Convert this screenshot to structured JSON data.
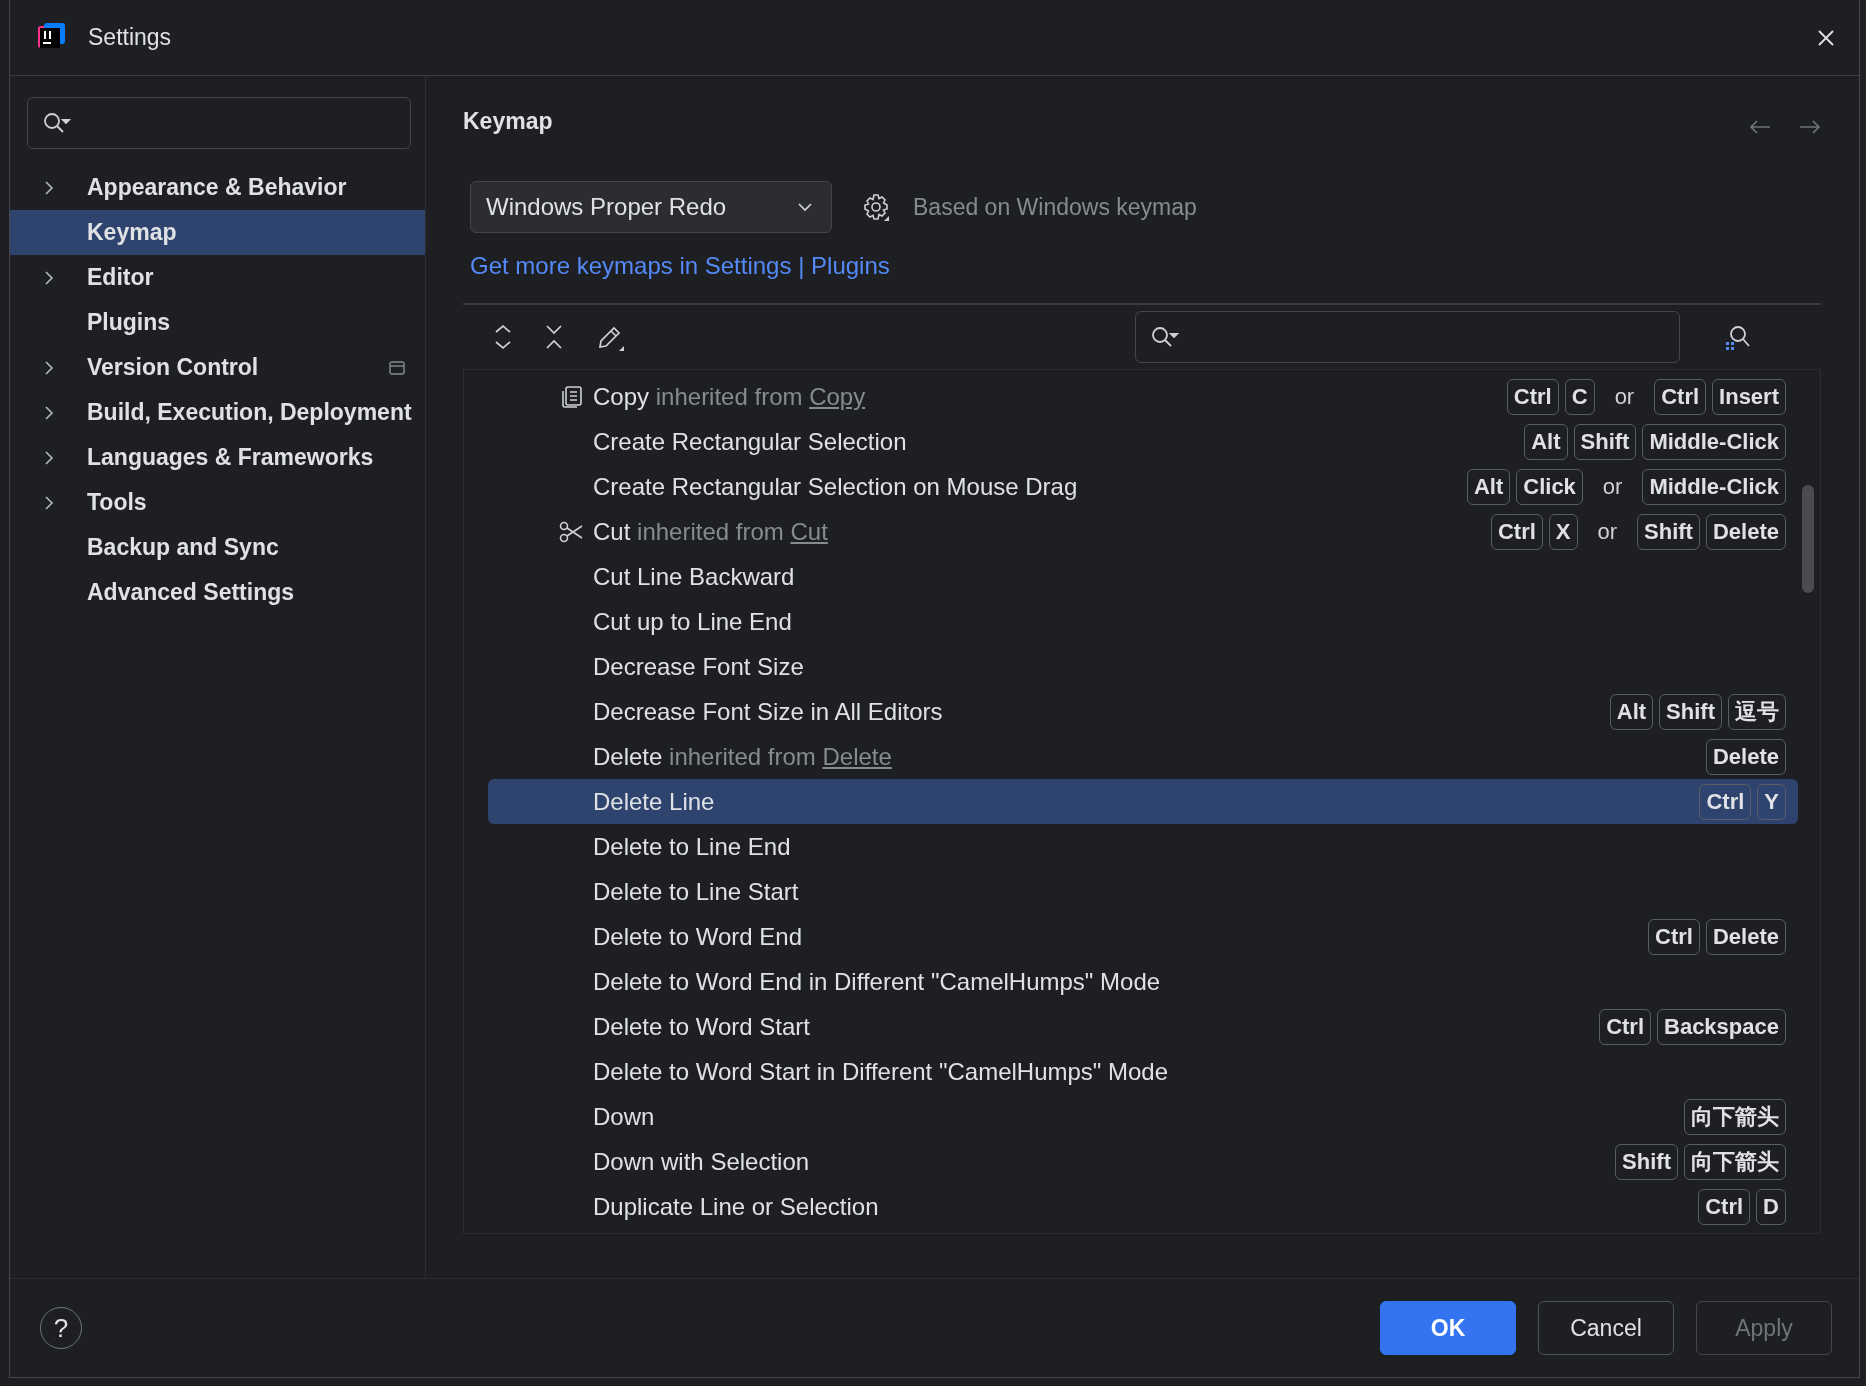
{
  "window": {
    "title": "Settings"
  },
  "sidebar": {
    "items": [
      {
        "label": "Appearance & Behavior",
        "expandable": true,
        "selected": false,
        "project_icon": false
      },
      {
        "label": "Keymap",
        "expandable": false,
        "selected": true,
        "project_icon": false
      },
      {
        "label": "Editor",
        "expandable": true,
        "selected": false,
        "project_icon": false
      },
      {
        "label": "Plugins",
        "expandable": false,
        "selected": false,
        "project_icon": false
      },
      {
        "label": "Version Control",
        "expandable": true,
        "selected": false,
        "project_icon": true
      },
      {
        "label": "Build, Execution, Deployment",
        "expandable": true,
        "selected": false,
        "project_icon": false
      },
      {
        "label": "Languages & Frameworks",
        "expandable": true,
        "selected": false,
        "project_icon": false
      },
      {
        "label": "Tools",
        "expandable": true,
        "selected": false,
        "project_icon": false
      },
      {
        "label": "Backup and Sync",
        "expandable": false,
        "selected": false,
        "project_icon": false
      },
      {
        "label": "Advanced Settings",
        "expandable": false,
        "selected": false,
        "project_icon": false
      }
    ]
  },
  "page": {
    "title": "Keymap",
    "keymap_select": {
      "value": "Windows Proper Redo"
    },
    "based_on": "Based on Windows keymap",
    "link": "Get more keymaps in Settings | Plugins"
  },
  "actions": {
    "rows": [
      {
        "name": "Copy",
        "kind": "copy",
        "inherited": {
          "prefix": "inherited from",
          "target": "Copy"
        },
        "selected": false,
        "shortcuts": [
          {
            "kind": "key",
            "text": "Ctrl"
          },
          {
            "kind": "key",
            "text": "C"
          },
          {
            "kind": "sep",
            "text": "or"
          },
          {
            "kind": "key",
            "text": "Ctrl"
          },
          {
            "kind": "key",
            "text": "Insert"
          }
        ]
      },
      {
        "name": "Create Rectangular Selection",
        "selected": false,
        "shortcuts": [
          {
            "kind": "key",
            "text": "Alt"
          },
          {
            "kind": "key",
            "text": "Shift"
          },
          {
            "kind": "key",
            "text": "Middle-Click"
          }
        ]
      },
      {
        "name": "Create Rectangular Selection on Mouse Drag",
        "selected": false,
        "shortcuts": [
          {
            "kind": "key",
            "text": "Alt"
          },
          {
            "kind": "key",
            "text": "Click"
          },
          {
            "kind": "sep",
            "text": "or"
          },
          {
            "kind": "key",
            "text": "Middle-Click"
          }
        ]
      },
      {
        "name": "Cut",
        "kind": "cut",
        "inherited": {
          "prefix": "inherited from",
          "target": "Cut"
        },
        "selected": false,
        "shortcuts": [
          {
            "kind": "key",
            "text": "Ctrl"
          },
          {
            "kind": "key",
            "text": "X"
          },
          {
            "kind": "sep",
            "text": "or"
          },
          {
            "kind": "key",
            "text": "Shift"
          },
          {
            "kind": "key",
            "text": "Delete"
          }
        ]
      },
      {
        "name": "Cut Line Backward",
        "selected": false
      },
      {
        "name": "Cut up to Line End",
        "selected": false
      },
      {
        "name": "Decrease Font Size",
        "selected": false
      },
      {
        "name": "Decrease Font Size in All Editors",
        "selected": false,
        "shortcuts": [
          {
            "kind": "key",
            "text": "Alt"
          },
          {
            "kind": "key",
            "text": "Shift"
          },
          {
            "kind": "key",
            "text": "逗号"
          }
        ]
      },
      {
        "name": "Delete",
        "inherited": {
          "prefix": "inherited from",
          "target": "Delete"
        },
        "selected": false,
        "shortcuts": [
          {
            "kind": "key",
            "text": "Delete"
          }
        ]
      },
      {
        "name": "Delete Line",
        "selected": true,
        "shortcuts": [
          {
            "kind": "key",
            "text": "Ctrl"
          },
          {
            "kind": "key",
            "text": "Y"
          }
        ]
      },
      {
        "name": "Delete to Line End",
        "selected": false
      },
      {
        "name": "Delete to Line Start",
        "selected": false
      },
      {
        "name": "Delete to Word End",
        "selected": false,
        "shortcuts": [
          {
            "kind": "key",
            "text": "Ctrl"
          },
          {
            "kind": "key",
            "text": "Delete"
          }
        ]
      },
      {
        "name": "Delete to Word End in Different \"CamelHumps\" Mode",
        "selected": false
      },
      {
        "name": "Delete to Word Start",
        "selected": false,
        "shortcuts": [
          {
            "kind": "key",
            "text": "Ctrl"
          },
          {
            "kind": "key",
            "text": "Backspace"
          }
        ]
      },
      {
        "name": "Delete to Word Start in Different \"CamelHumps\" Mode",
        "selected": false
      },
      {
        "name": "Down",
        "selected": false,
        "shortcuts": [
          {
            "kind": "key",
            "text": "向下箭头"
          }
        ]
      },
      {
        "name": "Down with Selection",
        "selected": false,
        "shortcuts": [
          {
            "kind": "key",
            "text": "Shift"
          },
          {
            "kind": "key",
            "text": "向下箭头"
          }
        ]
      },
      {
        "name": "Duplicate Line or Selection",
        "selected": false,
        "shortcuts": [
          {
            "kind": "key",
            "text": "Ctrl"
          },
          {
            "kind": "key",
            "text": "D"
          }
        ]
      }
    ]
  },
  "footer": {
    "help": "?",
    "buttons": [
      {
        "label": "OK",
        "kind": "primary",
        "disabled": false
      },
      {
        "label": "Cancel",
        "kind": "normal",
        "disabled": false
      },
      {
        "label": "Apply",
        "kind": "normal",
        "disabled": true
      }
    ]
  }
}
